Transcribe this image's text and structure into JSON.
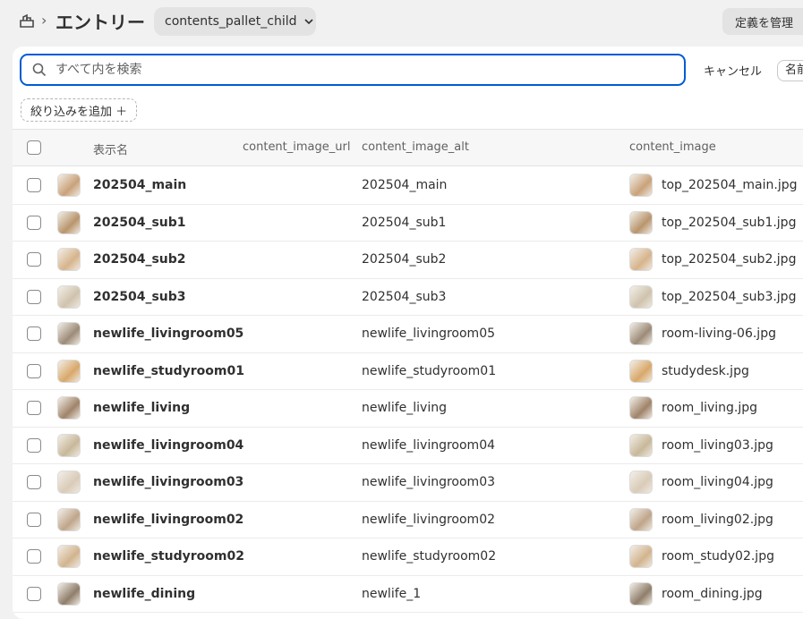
{
  "header": {
    "title": "エントリー",
    "definition_selector": "contents_pallet_child",
    "manage_button": "定義を管理"
  },
  "search": {
    "placeholder": "すべて内を検索",
    "value": "",
    "cancel_label": "キャンセル",
    "sort_label": "名前"
  },
  "filter": {
    "add_label": "絞り込みを追加 ＋"
  },
  "table": {
    "columns": [
      "表示名",
      "content_image_url",
      "content_image_alt",
      "content_image"
    ],
    "rows": [
      {
        "name": "202504_main",
        "url": "",
        "alt": "202504_main",
        "file": "top_202504_main.jpg"
      },
      {
        "name": "202504_sub1",
        "url": "",
        "alt": "202504_sub1",
        "file": "top_202504_sub1.jpg"
      },
      {
        "name": "202504_sub2",
        "url": "",
        "alt": "202504_sub2",
        "file": "top_202504_sub2.jpg"
      },
      {
        "name": "202504_sub3",
        "url": "",
        "alt": "202504_sub3",
        "file": "top_202504_sub3.jpg"
      },
      {
        "name": "newlife_livingroom05",
        "url": "",
        "alt": "newlife_livingroom05",
        "file": "room-living-06.jpg"
      },
      {
        "name": "newlife_studyroom01",
        "url": "",
        "alt": "newlife_studyroom01",
        "file": "studydesk.jpg"
      },
      {
        "name": "newlife_living",
        "url": "",
        "alt": "newlife_living",
        "file": "room_living.jpg"
      },
      {
        "name": "newlife_livingroom04",
        "url": "",
        "alt": "newlife_livingroom04",
        "file": "room_living03.jpg"
      },
      {
        "name": "newlife_livingroom03",
        "url": "",
        "alt": "newlife_livingroom03",
        "file": "room_living04.jpg"
      },
      {
        "name": "newlife_livingroom02",
        "url": "",
        "alt": "newlife_livingroom02",
        "file": "room_living02.jpg"
      },
      {
        "name": "newlife_studyroom02",
        "url": "",
        "alt": "newlife_studyroom02",
        "file": "room_study02.jpg"
      },
      {
        "name": "newlife_dining",
        "url": "",
        "alt": "newlife_1",
        "file": "room_dining.jpg"
      }
    ]
  },
  "thumb_colors": [
    "#c9a27a",
    "#b8956d",
    "#d6b48c",
    "#cfc3ad",
    "#9c8b78",
    "#d8a86a",
    "#a0836a",
    "#c8b89a",
    "#d9cbb8",
    "#bfa58a",
    "#d2b48e",
    "#8f7e6a"
  ]
}
